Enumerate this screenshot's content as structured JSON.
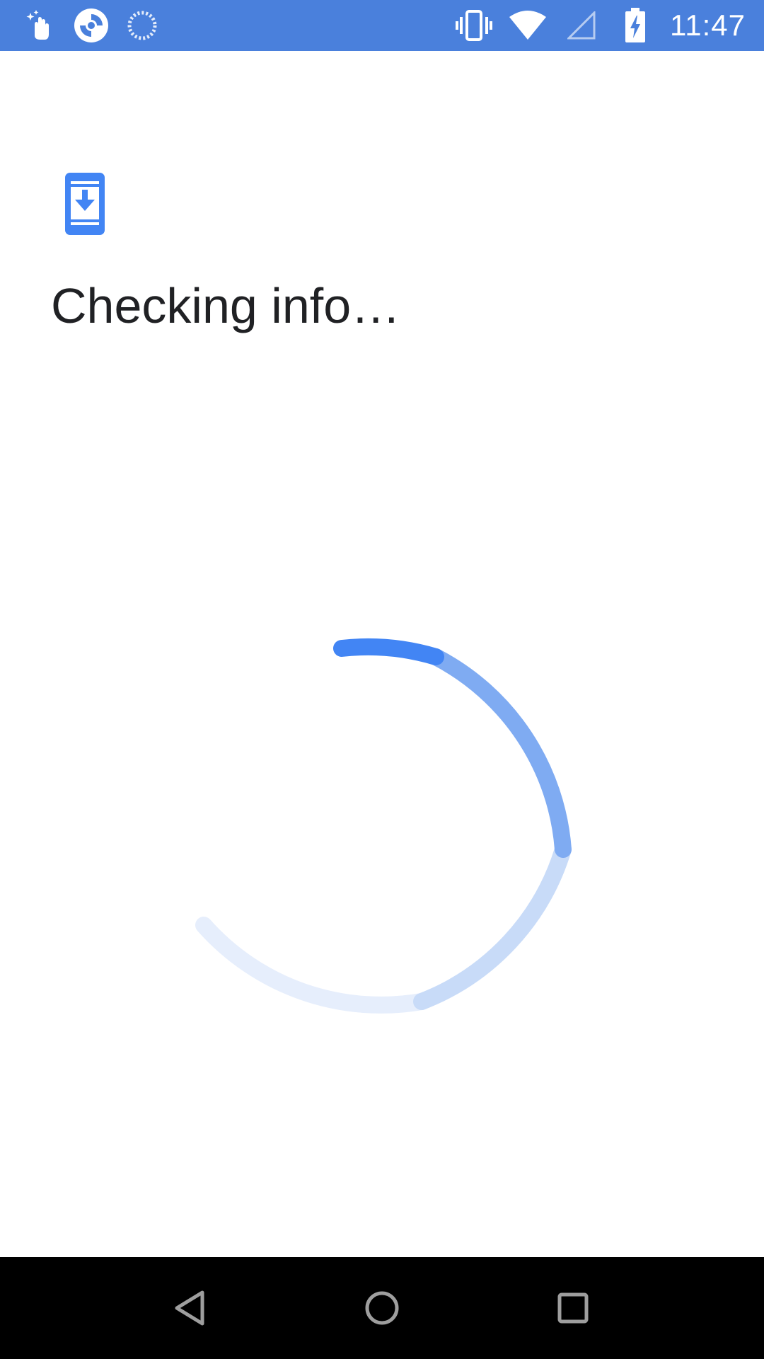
{
  "status_bar": {
    "time": "11:47",
    "background_color": "#4a80dc",
    "left_icons": [
      "gesture-hand-icon",
      "app-sync-icon",
      "loading-ring-icon"
    ],
    "right_icons": [
      "vibrate-icon",
      "wifi-icon",
      "cell-signal-icon",
      "battery-charging-icon"
    ]
  },
  "main": {
    "header_icon": "phone-download-icon",
    "title": "Checking info…",
    "accent_color": "#4285f4",
    "spinner": "loading-spinner"
  },
  "nav_bar": {
    "buttons": [
      "back-icon",
      "home-icon",
      "recents-icon"
    ]
  }
}
